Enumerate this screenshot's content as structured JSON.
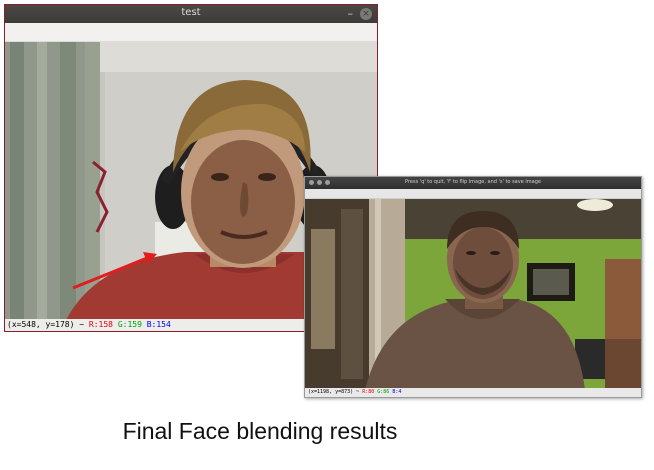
{
  "window1": {
    "title": "test",
    "minimize_glyph": "–",
    "close_glyph": "×",
    "status": {
      "coords": "(x=548, y=178) ~",
      "r": "R:158",
      "g": "G:159",
      "b": "B:154"
    }
  },
  "window2": {
    "title": "Press 'q' to quit, 'f' to flip image, and 's' to save image",
    "status": {
      "coords": "(x=1198, y=873) ~",
      "r": "R:80",
      "g": "G:86",
      "b": "B:4"
    }
  },
  "caption": "Final Face blending results",
  "colors": {
    "window1_border": "#8a1f2a",
    "arrow": "#e01e1e",
    "status_red": "#e00000",
    "status_green": "#00a000",
    "status_blue": "#0000e0"
  },
  "icons": {
    "window1_close": "close-icon",
    "window1_minimize": "minimize-icon",
    "window2_buttons": "traffic-light-dot-icon"
  }
}
